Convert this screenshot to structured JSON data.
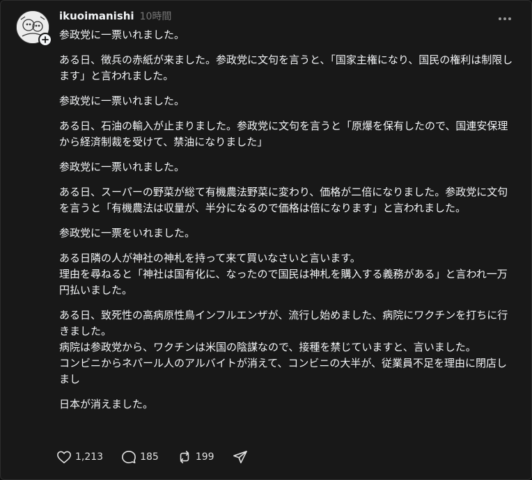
{
  "post": {
    "username": "ikuoimanishi",
    "timestamp": "10時間",
    "paragraphs": [
      "参政党に一票いれました。",
      "ある日、徴兵の赤紙が来ました。参政党に文句を言うと、「国家主権になり、国民の権利は制限します」と言われました。",
      "参政党に一票いれました。",
      "ある日、石油の輸入が止まりました。参政党に文句を言うと「原爆を保有したので、国連安保理から経済制裁を受けて、禁油になりました」",
      "参政党に一票いれました。",
      "ある日、スーパーの野菜が総て有機農法野菜に変わり、価格が二倍になりました。参政党に文句を言うと「有機農法は収量が、半分になるので価格は倍になります」と言われました。",
      "参政党に一票をいれました。",
      "ある日隣の人が神社の神札を持って来て買いなさいと言います。\n理由を尋ねると「神社は国有化に、なったので国民は神札を購入する義務がある」と言われ一万円払いました。",
      "ある日、致死性の高病原性鳥インフルエンザが、流行し始めました、病院にワクチンを打ちに行きました。\n病院は参政党から、ワクチンは米国の陰謀なので、接種を禁じていますと、言いました。\nコンビニからネパール人のアルバイトが消えて、コンビニの大半が、従業員不足を理由に閉店しまし",
      "日本が消えました。"
    ]
  },
  "actions": {
    "likes": "1,213",
    "replies": "185",
    "reposts": "199",
    "like_icon": "heart-icon",
    "reply_icon": "comment-icon",
    "repost_icon": "repost-icon",
    "share_icon": "share-icon"
  },
  "colors": {
    "background": "#181818",
    "text": "#f3f5f7",
    "muted": "#777777"
  }
}
